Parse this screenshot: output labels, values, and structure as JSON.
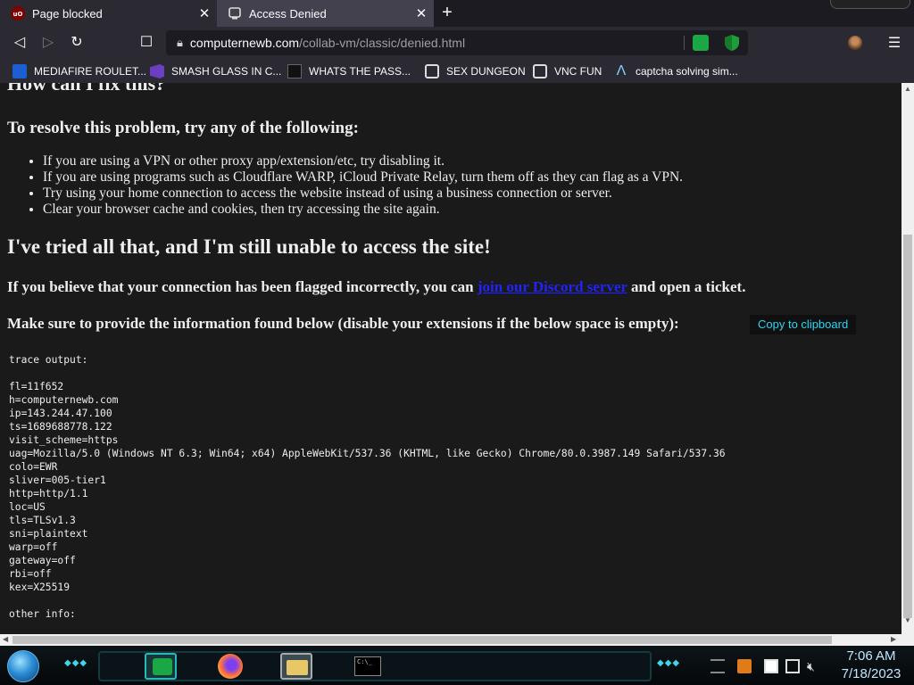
{
  "tabs": [
    {
      "title": "Page blocked",
      "active": false,
      "favicon": "ublock-origin-icon"
    },
    {
      "title": "Access Denied",
      "active": true,
      "favicon": "collabvm-icon"
    }
  ],
  "newtab_symbol": "+",
  "nav": {
    "back": "◁",
    "forward": "▷",
    "reload": "↻",
    "bookmark": "☐",
    "url_host": "computernewb.com",
    "url_path": "/collab-vm/classic/denied.html",
    "menu": "☰"
  },
  "bookmarks": [
    {
      "label": "MEDIAFIRE ROULET...",
      "icon": "mediafire-icon"
    },
    {
      "label": "SMASH GLASS IN C...",
      "icon": "vs-icon"
    },
    {
      "label": "WHATS THE PASS...",
      "icon": "dark-box-icon"
    },
    {
      "label": "SEX DUNGEON",
      "icon": "collabvm-icon"
    },
    {
      "label": "VNC FUN",
      "icon": "collabvm-icon"
    },
    {
      "label": "captcha solving sim...",
      "icon": "caret-icon"
    }
  ],
  "page": {
    "cut_heading": "How can I fix this?",
    "resolve_heading": "To resolve this problem, try any of the following:",
    "tips": [
      "If you are using a VPN or other proxy app/extension/etc, try disabling it.",
      "If you are using programs such as Cloudflare WARP, iCloud Private Relay, turn them off as they can flag as a VPN.",
      "Try using your home connection to access the website instead of using a business connection or server.",
      "Clear your browser cache and cookies, then try accessing the site again."
    ],
    "tried_heading": "I've tried all that, and I'm still unable to access the site!",
    "believe_before": "If you believe that your connection has been flagged incorrectly, you can ",
    "believe_link": "join our Discord server",
    "believe_after": " and open a ticket.",
    "provide_text": "Make sure to provide the information found below (disable your extensions if the below space is empty):",
    "copy_button": "Copy to clipboard",
    "trace_lines": [
      "trace output:",
      "",
      "fl=11f652",
      "h=computernewb.com",
      "ip=143.244.47.100",
      "ts=1689688778.122",
      "visit_scheme=https",
      "uag=Mozilla/5.0 (Windows NT 6.3; Win64; x64) AppleWebKit/537.36 (KHTML, like Gecko) Chrome/80.0.3987.149 Safari/537.36",
      "colo=EWR",
      "sliver=005-tier1",
      "http=http/1.1",
      "loc=US",
      "tls=TLSv1.3",
      "sni=plaintext",
      "warp=off",
      "gateway=off",
      "rbi=off",
      "kex=X25519",
      "",
      "other info:"
    ]
  },
  "taskbar": {
    "apps": [
      "notes-app-icon",
      "firefox-icon",
      "file-explorer-icon",
      "command-prompt-icon"
    ],
    "cmd_text": "C:\\_",
    "clock_time": "7:06 AM",
    "clock_date": "7/18/2023"
  },
  "colors": {
    "accent_link": "#2222ff",
    "copy_button_text": "#2bd5f5",
    "page_bg": "#1a1a1a",
    "chrome_bg": "#2b2a33"
  }
}
